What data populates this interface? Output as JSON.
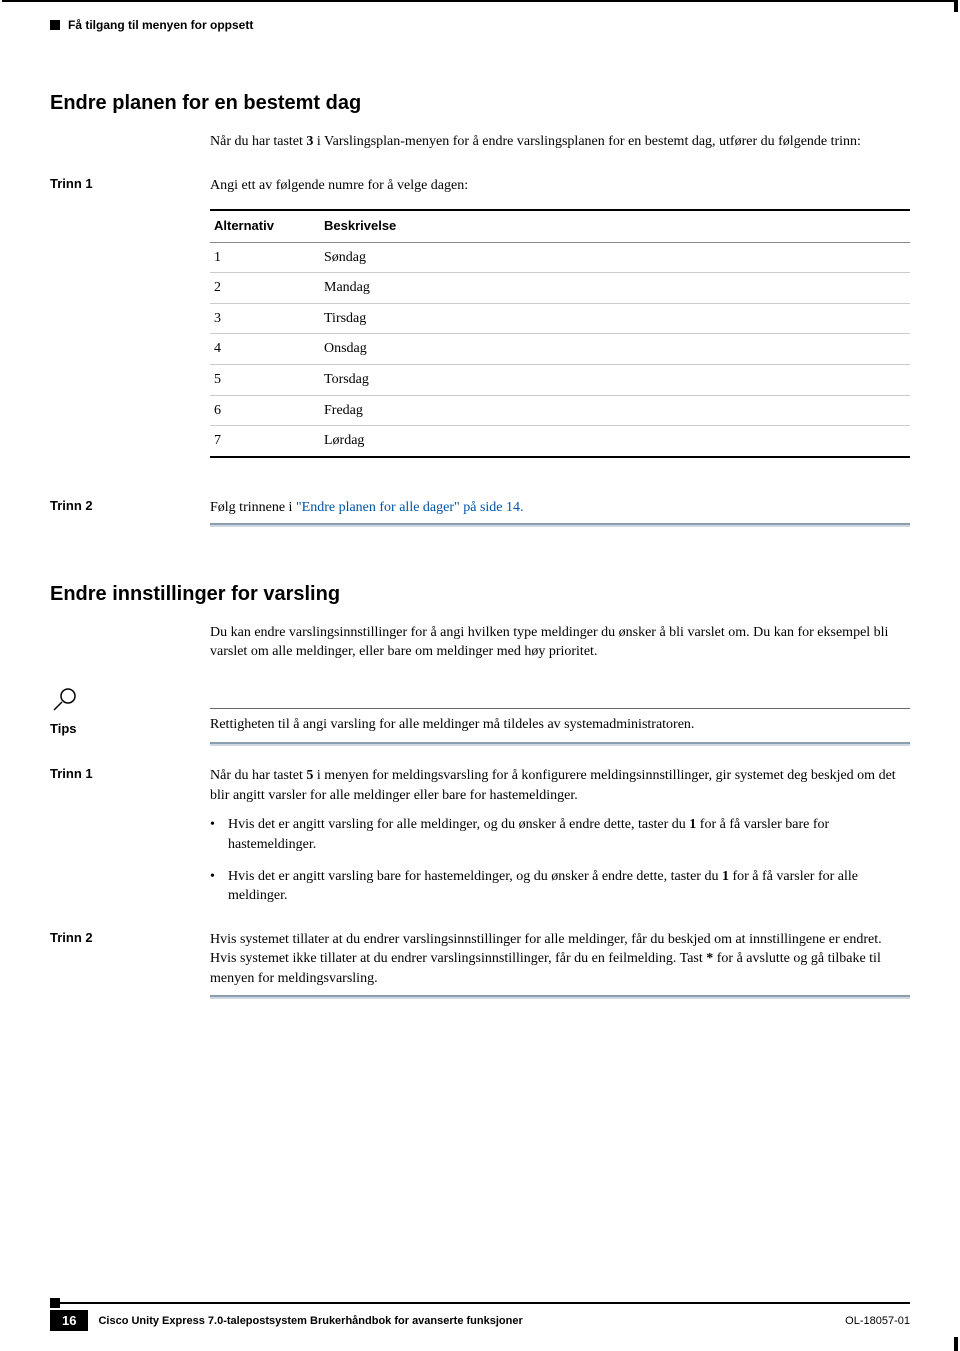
{
  "running_head": "Få tilgang til menyen for oppsett",
  "section1": {
    "title": "Endre planen for en bestemt dag",
    "intro_a": "Når du har tastet ",
    "intro_key": "3",
    "intro_b": " i Varslingsplan-menyen for å endre varslingsplanen for en bestemt dag, utfører du følgende trinn:",
    "step1_label": "Trinn 1",
    "step1_text": "Angi ett av følgende numre for å velge dagen:",
    "table": {
      "col1": "Alternativ",
      "col2": "Beskrivelse",
      "rows": [
        {
          "k": "1",
          "v": "Søndag"
        },
        {
          "k": "2",
          "v": "Mandag"
        },
        {
          "k": "3",
          "v": "Tirsdag"
        },
        {
          "k": "4",
          "v": "Onsdag"
        },
        {
          "k": "5",
          "v": "Torsdag"
        },
        {
          "k": "6",
          "v": "Fredag"
        },
        {
          "k": "7",
          "v": "Lørdag"
        }
      ]
    },
    "step2_label": "Trinn 2",
    "step2_a": "Følg trinnene i ",
    "step2_link": "\"Endre planen for alle dager\" på side 14.",
    "step2_c": ""
  },
  "section2": {
    "title": "Endre innstillinger for varsling",
    "intro": "Du kan endre varslingsinnstillinger for å angi hvilken type meldinger du ønsker å bli varslet om. Du kan for eksempel bli varslet om alle meldinger, eller bare om meldinger med høy prioritet.",
    "tips_label": "Tips",
    "tips_text": "Rettigheten til å angi varsling for alle meldinger må tildeles av systemadministratoren.",
    "step1_label": "Trinn 1",
    "step1_a": "Når du har tastet ",
    "step1_key": "5",
    "step1_b": " i menyen for meldingsvarsling for å konfigurere meldingsinnstillinger, gir systemet deg beskjed om det blir angitt varsler for alle meldinger eller bare for hastemeldinger.",
    "bullets": [
      {
        "a": "Hvis det er angitt varsling for alle meldinger, og du ønsker å endre dette, taster du ",
        "key": "1",
        "b": " for å få varsler bare for hastemeldinger."
      },
      {
        "a": "Hvis det er angitt varsling bare for hastemeldinger, og du ønsker å endre dette, taster du ",
        "key": "1",
        "b": " for å få varsler for alle meldinger."
      }
    ],
    "step2_label": "Trinn 2",
    "step2_a": "Hvis systemet tillater at du endrer varslingsinnstillinger for alle meldinger, får du beskjed om at innstillingene er endret. Hvis systemet ikke tillater at du endrer varslingsinnstillinger, får du en feilmelding. Tast ",
    "step2_key": "*",
    "step2_b": " for å avslutte og gå tilbake til menyen for meldingsvarsling."
  },
  "footer": {
    "title": "Cisco Unity Express 7.0-talepostsystem Brukerhåndbok for avanserte funksjoner",
    "page": "16",
    "doc": "OL-18057-01"
  }
}
